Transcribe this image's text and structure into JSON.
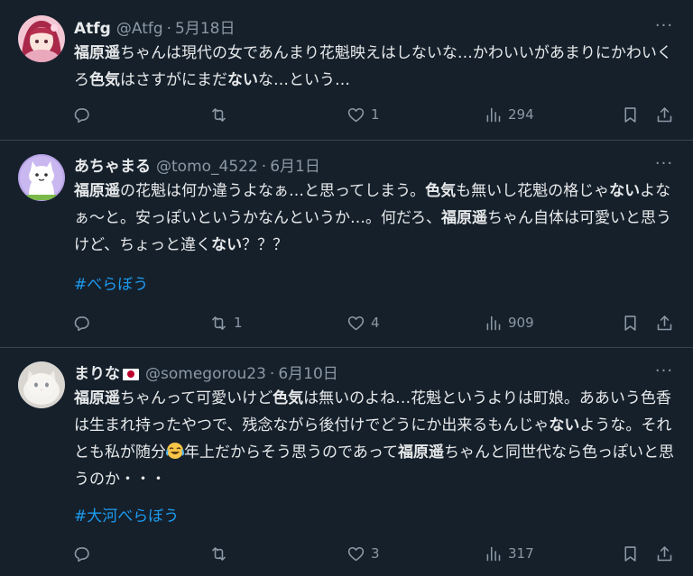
{
  "tweets": [
    {
      "name": "Atfg",
      "handle": "@Atfg",
      "date": "5月18日",
      "has_flag": false,
      "text_segments": [
        {
          "t": "福原遥",
          "b": true
        },
        {
          "t": "ちゃんは現代の女であんまり花魁映えはしないな…かわいいがあまりにかわいくろ",
          "b": false
        },
        {
          "t": "色気",
          "b": true
        },
        {
          "t": "はさすがにまだ",
          "b": false
        },
        {
          "t": "ない",
          "b": true
        },
        {
          "t": "な…という…",
          "b": false
        }
      ],
      "hashtag": "",
      "reply_count": "",
      "retweet_count": "",
      "like_count": "1",
      "view_count": "294",
      "avatar": "anime-girl-avatar"
    },
    {
      "name": "あちゃまる",
      "handle": "@tomo_4522",
      "date": "6月1日",
      "has_flag": false,
      "text_segments": [
        {
          "t": "福原遥",
          "b": true
        },
        {
          "t": "の花魁は何か違うよなぁ…と思ってしまう。",
          "b": false
        },
        {
          "t": "色気",
          "b": true
        },
        {
          "t": "も無いし花魁の格じゃ",
          "b": false
        },
        {
          "t": "ない",
          "b": true
        },
        {
          "t": "よなぁ〜と。安っぽいというかなんというか…。何だろ、",
          "b": false
        },
        {
          "t": "福原遥",
          "b": true
        },
        {
          "t": "ちゃん自体は可愛いと思うけど、ちょっと違く",
          "b": false
        },
        {
          "t": "ない",
          "b": true
        },
        {
          "t": "？？？",
          "b": false
        }
      ],
      "hashtag": "#べらぼう",
      "reply_count": "",
      "retweet_count": "1",
      "like_count": "4",
      "view_count": "909",
      "avatar": "cat-cartoon-avatar"
    },
    {
      "name": "まりな",
      "handle": "@somegorou23",
      "date": "6月10日",
      "has_flag": true,
      "text_segments": [
        {
          "t": "福原遥",
          "b": true
        },
        {
          "t": "ちゃんって可愛いけど",
          "b": false
        },
        {
          "t": "色気",
          "b": true
        },
        {
          "t": "は無いのよね…花魁というよりは町娘。ああいう色香は生まれ持ったやつで、残念ながら後付けでどうにか出来るもんじゃ",
          "b": false
        },
        {
          "t": "ない",
          "b": true
        },
        {
          "t": "ような。それとも私が随分",
          "b": false
        },
        {
          "t": "[emoji]",
          "b": false
        },
        {
          "t": "年上だからそう思うのであって",
          "b": false
        },
        {
          "t": "福原遥",
          "b": true
        },
        {
          "t": "ちゃんと同世代なら色っぽいと思うのか・・・",
          "b": false
        }
      ],
      "hashtag": "#大河べらぼう",
      "reply_count": "",
      "retweet_count": "",
      "like_count": "3",
      "view_count": "317",
      "avatar": "white-cat-photo-avatar"
    }
  ],
  "icons": {
    "reply": "reply-icon",
    "retweet": "retweet-icon",
    "like": "heart-icon",
    "views": "views-icon",
    "bookmark": "bookmark-icon",
    "share": "share-icon",
    "more": "more-icon",
    "emoji": "tears-of-joy-emoji"
  },
  "colors": {
    "background": "#15202b",
    "text": "#e7e9ea",
    "secondary": "#8b98a5",
    "link": "#1d9bf0",
    "divider": "#38444d"
  }
}
